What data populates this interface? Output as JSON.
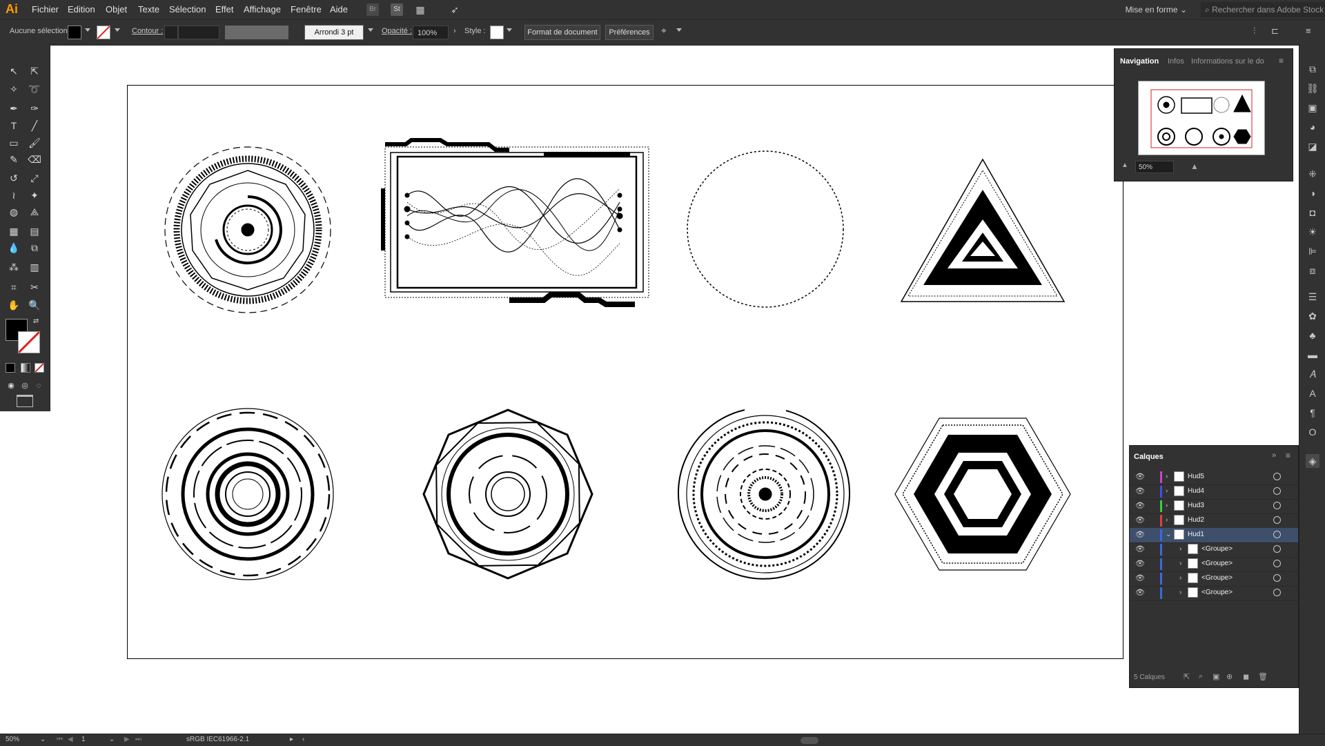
{
  "app": {
    "logo": "Ai"
  },
  "menu": {
    "items": [
      "Fichier",
      "Edition",
      "Objet",
      "Texte",
      "Sélection",
      "Effet",
      "Affichage",
      "Fenêtre",
      "Aide"
    ],
    "bridge_icon": "Br",
    "stock_icon": "St",
    "workspace": "Mise en forme",
    "search_placeholder": "Rechercher dans Adobe Stock"
  },
  "controlbar": {
    "selection_status": "Aucune sélection",
    "stroke_label": "Contour :",
    "brush_value": "Arrondi 3 pt",
    "opacity_label": "Opacité :",
    "opacity_value": "100%",
    "style_label": "Style :",
    "document_format_button": "Format de document",
    "preferences_button": "Préférences",
    "fill_color": "#000000",
    "stroke_color": "#ffffff"
  },
  "navigation_panel": {
    "tabs": [
      "Navigation",
      "Infos",
      "Informations sur le do"
    ],
    "active_tab": "Navigation",
    "zoom": "50%"
  },
  "layers_panel": {
    "title": "Calques",
    "layers": [
      {
        "name": "Hud5",
        "color": "#d040d0",
        "expanded": false,
        "selected": false,
        "sublayer": false
      },
      {
        "name": "Hud4",
        "color": "#4a4af0",
        "expanded": false,
        "selected": false,
        "sublayer": false
      },
      {
        "name": "Hud3",
        "color": "#3ad03a",
        "expanded": false,
        "selected": false,
        "sublayer": false
      },
      {
        "name": "Hud2",
        "color": "#e04040",
        "expanded": false,
        "selected": false,
        "sublayer": false
      },
      {
        "name": "Hud1",
        "color": "#3a6ae0",
        "expanded": true,
        "selected": true,
        "sublayer": false
      },
      {
        "name": "<Groupe>",
        "color": "#3a6ae0",
        "expanded": false,
        "selected": false,
        "sublayer": true
      },
      {
        "name": "<Groupe>",
        "color": "#3a6ae0",
        "expanded": false,
        "selected": false,
        "sublayer": true
      },
      {
        "name": "<Groupe>",
        "color": "#3a6ae0",
        "expanded": false,
        "selected": false,
        "sublayer": true
      },
      {
        "name": "<Groupe>",
        "color": "#3a6ae0",
        "expanded": false,
        "selected": false,
        "sublayer": true
      }
    ],
    "footer": "5 Calques"
  },
  "statusbar": {
    "zoom": "50%",
    "artboard_number": "1",
    "color_profile": "sRGB IEC61966-2.1"
  }
}
